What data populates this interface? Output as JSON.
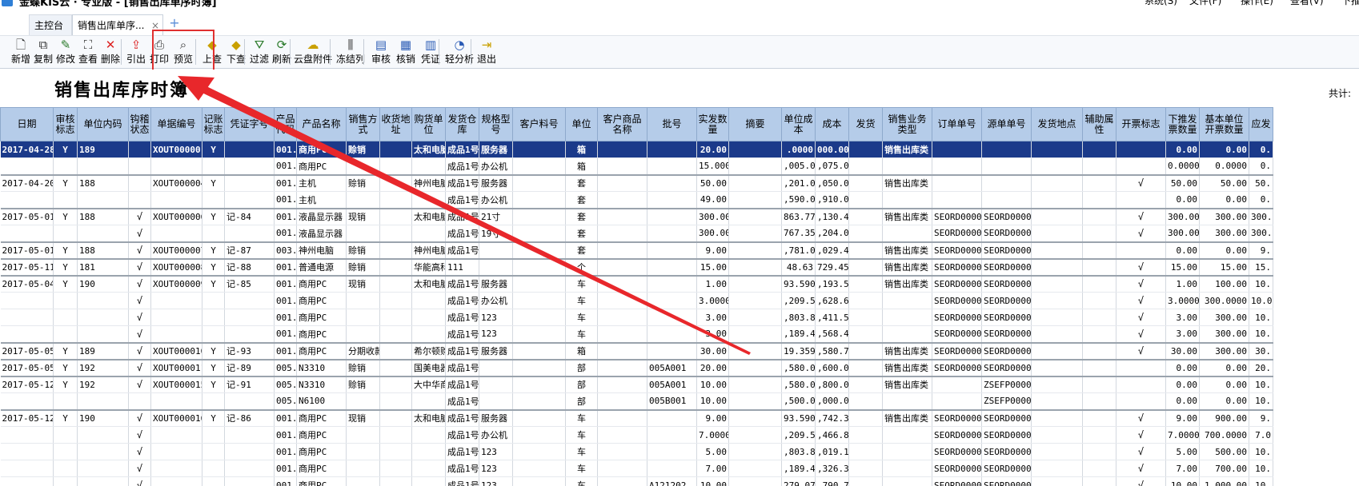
{
  "window": {
    "title": "金蝶KIS云 · 专业版 - [销售出库单序时簿]",
    "menus": [
      "系统(S)",
      "文件(F)",
      "操作(E)",
      "查看(V)",
      "下推(P)"
    ]
  },
  "tabs": {
    "main": "主控台",
    "active": "销售出库单序...",
    "close": "×",
    "add": "+"
  },
  "toolbar": {
    "buttons": [
      {
        "label": "新增",
        "icon": "new-doc-icon",
        "glyph": "🗋"
      },
      {
        "label": "复制",
        "icon": "copy-icon",
        "glyph": "⧉"
      },
      {
        "label": "修改",
        "icon": "edit-icon",
        "glyph": "✎"
      },
      {
        "label": "查看",
        "icon": "binoculars-icon",
        "glyph": "⛶"
      },
      {
        "label": "删除",
        "icon": "delete-icon",
        "glyph": "✕"
      },
      {
        "label": "引出",
        "icon": "export-icon",
        "glyph": "⇪"
      },
      {
        "label": "打印",
        "icon": "print-icon",
        "glyph": "⎙"
      },
      {
        "label": "预览",
        "icon": "preview-icon",
        "glyph": "⌕"
      },
      {
        "label": "上查",
        "icon": "up-query-icon",
        "glyph": "◆"
      },
      {
        "label": "下查",
        "icon": "down-query-icon",
        "glyph": "◆"
      },
      {
        "label": "过滤",
        "icon": "filter-icon",
        "glyph": "⛛"
      },
      {
        "label": "刷新",
        "icon": "refresh-icon",
        "glyph": "⟳"
      },
      {
        "label": "云盘附件",
        "icon": "cloud-attach-icon",
        "glyph": "☁"
      },
      {
        "label": "冻结列",
        "icon": "freeze-column-icon",
        "glyph": "⫼"
      },
      {
        "label": "审核",
        "icon": "audit-icon",
        "glyph": "▤"
      },
      {
        "label": "核销",
        "icon": "writeoff-icon",
        "glyph": "▦"
      },
      {
        "label": "凭证",
        "icon": "voucher-icon",
        "glyph": "▥"
      },
      {
        "label": "轻分析",
        "icon": "analysis-icon",
        "glyph": "◔"
      },
      {
        "label": "退出",
        "icon": "exit-icon",
        "glyph": "⇥"
      }
    ]
  },
  "report": {
    "title": "销售出库序时簿",
    "total_label": "共计:"
  },
  "colors": {
    "header_bg": "#b5cce9",
    "selected_row_bg": "#1b3a8a",
    "annotation_red": "#e03030"
  },
  "table": {
    "columns": [
      "日期",
      "审核标志",
      "单位内码",
      "钩稽状态",
      "单据编号",
      "记账标志",
      "凭证字号",
      "产品代码",
      "产品名称",
      "销售方式",
      "收货地址",
      "购货单位",
      "发货仓库",
      "规格型号",
      "客户料号",
      "单位",
      "客户商品名称",
      "批号",
      "实发数量",
      "摘要",
      "单位成本",
      "成本",
      "发货",
      "销售业务类型",
      "订单单号",
      "源单单号",
      "发货地点",
      "辅助属性",
      "开票标志",
      "下推发票数量",
      "基本单位开票数量",
      "应发"
    ],
    "rows": [
      {
        "sel": true,
        "gb": true,
        "c": [
          "2017-04-28",
          "Y",
          "189",
          "",
          "XOUT00000",
          "Y",
          "",
          "001.",
          "商用PC",
          "赊销",
          "",
          "太和电脑",
          "成品1号",
          "服务器",
          "",
          "箱",
          "",
          "",
          "20.00",
          "",
          ".0000",
          "000.00",
          "",
          "销售出库类",
          "",
          "",
          "",
          "",
          "",
          "0.00",
          "0.00",
          "0."
        ]
      },
      {
        "sel": false,
        "gb": false,
        "c": [
          "",
          "",
          "",
          "",
          "",
          "",
          "",
          "001.",
          "商用PC",
          "",
          "",
          "",
          "成品1号",
          "办公机",
          "",
          "箱",
          "",
          "",
          "15.0000",
          "",
          ",005.00",
          ",075.00",
          "",
          "",
          "",
          "",
          "",
          "",
          "",
          "0.0000",
          "0.0000",
          "0."
        ]
      },
      {
        "sel": false,
        "gb": true,
        "c": [
          "2017-04-20",
          "Y",
          "188",
          "",
          "XOUT000004",
          "Y",
          "",
          "001.",
          "主机",
          "赊销",
          "",
          "神州电脑",
          "成品1号",
          "服务器",
          "",
          "套",
          "",
          "",
          "50.00",
          "",
          ",201.00",
          ",050.00",
          "",
          "销售出库类",
          "",
          "",
          "",
          "",
          "√",
          "50.00",
          "50.00",
          "50."
        ]
      },
      {
        "sel": false,
        "gb": false,
        "c": [
          "",
          "",
          "",
          "",
          "",
          "",
          "",
          "001.",
          "主机",
          "",
          "",
          "",
          "成品1号",
          "办公机",
          "",
          "套",
          "",
          "",
          "49.00",
          "",
          ",590.00",
          ",910.00",
          "",
          "",
          "",
          "",
          "",
          "",
          "",
          "0.00",
          "0.00",
          "0."
        ]
      },
      {
        "sel": false,
        "gb": true,
        "c": [
          "2017-05-01",
          "Y",
          "188",
          "√",
          "XOUT000006",
          "Y",
          "记-84",
          "001.",
          "液晶显示器",
          "现销",
          "",
          "太和电脑",
          "成品1号",
          "21寸",
          "",
          "套",
          "",
          "",
          "300.00",
          "",
          "863.77",
          ",130.43",
          "",
          "销售出库类",
          "SEORD000001",
          "SEORD000001",
          "",
          "",
          "√",
          "300.00",
          "300.00",
          "300."
        ]
      },
      {
        "sel": false,
        "gb": false,
        "c": [
          "",
          "",
          "",
          "√",
          "",
          "",
          "",
          "001.",
          "液晶显示器",
          "",
          "",
          "",
          "成品1号",
          "19寸",
          "",
          "套",
          "",
          "",
          "300.00",
          "",
          "767.35",
          ",204.08",
          "",
          "",
          "SEORD000001",
          "SEORD000001",
          "",
          "",
          "√",
          "300.00",
          "300.00",
          "300."
        ]
      },
      {
        "sel": false,
        "gb": true,
        "c": [
          "2017-05-01",
          "Y",
          "188",
          "√",
          "XOUT000007",
          "Y",
          "记-87",
          "003.",
          "神州电脑",
          "赊销",
          "",
          "神州电脑",
          "成品1号",
          "",
          "",
          "套",
          "",
          "",
          "9.00",
          "",
          ",781.05",
          ",029.41",
          "",
          "销售出库类",
          "SEORD000002",
          "SEORD000002",
          "",
          "",
          "",
          "0.00",
          "0.00",
          "9."
        ]
      },
      {
        "sel": false,
        "gb": true,
        "c": [
          "2017-05-11",
          "Y",
          "181",
          "√",
          "XOUT000008",
          "Y",
          "记-88",
          "001.",
          "普通电源",
          "赊销",
          "",
          "华能高科",
          "111",
          "",
          "",
          "个",
          "",
          "",
          "15.00",
          "",
          "48.63",
          "729.45",
          "",
          "销售出库类",
          "SEORD000003",
          "SEORD000003",
          "",
          "",
          "√",
          "15.00",
          "15.00",
          "15."
        ]
      },
      {
        "sel": false,
        "gb": true,
        "c": [
          "2017-05-04",
          "Y",
          "190",
          "√",
          "XOUT000009",
          "Y",
          "记-85",
          "001.",
          "商用PC",
          "现销",
          "",
          "太和电脑",
          "成品1号",
          "服务器",
          "",
          "车",
          "",
          "",
          "1.00",
          "",
          "93.5903",
          ",193.59",
          "",
          "销售出库类",
          "SEORD000004",
          "SEORD000004",
          "",
          "",
          "√",
          "1.00",
          "100.00",
          "10."
        ]
      },
      {
        "sel": false,
        "gb": false,
        "c": [
          "",
          "",
          "",
          "√",
          "",
          "",
          "",
          "001.",
          "商用PC",
          "",
          "",
          "",
          "成品1号",
          "办公机",
          "",
          "车",
          "",
          "",
          "3.0000",
          "",
          ",209.55",
          ",628.65",
          "",
          "",
          "SEORD000004",
          "SEORD000004",
          "",
          "",
          "√",
          "3.0000",
          "300.0000",
          "10.0"
        ]
      },
      {
        "sel": false,
        "gb": false,
        "c": [
          "",
          "",
          "",
          "√",
          "",
          "",
          "",
          "001.",
          "商用PC",
          "",
          "",
          "",
          "成品1号",
          "123",
          "",
          "车",
          "",
          "",
          "3.00",
          "",
          ",803.84",
          ",411.51",
          "",
          "",
          "SEORD000004",
          "SEORD000004",
          "",
          "",
          "√",
          "3.00",
          "300.00",
          "10."
        ]
      },
      {
        "sel": false,
        "gb": false,
        "c": [
          "",
          "",
          "",
          "√",
          "",
          "",
          "",
          "001.",
          "商用PC",
          "",
          "",
          "",
          "成品1号",
          "123",
          "",
          "车",
          "",
          "",
          "3.00",
          "",
          ",189.48",
          ",568.44",
          "",
          "",
          "SEORD000004",
          "SEORD000004",
          "",
          "",
          "√",
          "3.00",
          "300.00",
          "10."
        ]
      },
      {
        "sel": false,
        "gb": true,
        "c": [
          "2017-05-05",
          "Y",
          "189",
          "√",
          "XOUT000010",
          "Y",
          "记-93",
          "001.",
          "商用PC",
          "分期收款",
          "",
          "希尔顿购",
          "成品1号",
          "服务器",
          "",
          "箱",
          "",
          "",
          "30.00",
          "",
          "19.3590",
          ",580.77",
          "",
          "销售出库类",
          "SEORD000006",
          "SEORD000006",
          "",
          "",
          "√",
          "30.00",
          "300.00",
          "30."
        ]
      },
      {
        "sel": false,
        "gb": true,
        "c": [
          "2017-05-05",
          "Y",
          "192",
          "√",
          "XOUT000011",
          "Y",
          "记-89",
          "005.",
          "N3310",
          "赊销",
          "",
          "国美电器",
          "成品1号",
          "",
          "",
          "部",
          "",
          "005A001",
          "20.00",
          "",
          ",580.00",
          ",600.00",
          "",
          "销售出库类",
          "SEORD000008",
          "SEORD000008",
          "",
          "",
          "",
          "0.00",
          "0.00",
          "20."
        ]
      },
      {
        "sel": false,
        "gb": true,
        "c": [
          "2017-05-12",
          "Y",
          "192",
          "√",
          "XOUT000015",
          "Y",
          "记-91",
          "005.",
          "N3310",
          "赊销",
          "",
          "大中华商",
          "成品1号",
          "",
          "",
          "部",
          "",
          "005A001",
          "10.00",
          "",
          ",580.00",
          ",800.00",
          "",
          "销售出库类",
          "",
          "ZSEFP000006",
          "",
          "",
          "",
          "0.00",
          "0.00",
          "10."
        ]
      },
      {
        "sel": false,
        "gb": false,
        "c": [
          "",
          "",
          "",
          "",
          "",
          "",
          "",
          "005.",
          "N6100",
          "",
          "",
          "",
          "成品1号",
          "",
          "",
          "部",
          "",
          "005B001",
          "10.00",
          "",
          ",500.00",
          ",000.00",
          "",
          "",
          "",
          "ZSEFP000006",
          "",
          "",
          "",
          "0.00",
          "0.00",
          "10."
        ]
      },
      {
        "sel": false,
        "gb": true,
        "c": [
          "2017-05-12",
          "Y",
          "190",
          "√",
          "XOUT000016",
          "Y",
          "记-86",
          "001.",
          "商用PC",
          "现销",
          "",
          "太和电脑",
          "成品1号",
          "服务器",
          "",
          "车",
          "",
          "",
          "9.00",
          "",
          "93.5903",
          ",742.31",
          "",
          "销售出库类",
          "SEORD000004",
          "SEORD000004",
          "",
          "",
          "√",
          "9.00",
          "900.00",
          "9."
        ]
      },
      {
        "sel": false,
        "gb": false,
        "c": [
          "",
          "",
          "",
          "√",
          "",
          "",
          "",
          "001.",
          "商用PC",
          "",
          "",
          "",
          "成品1号",
          "办公机",
          "",
          "车",
          "",
          "",
          "7.0000",
          "",
          ",209.55",
          ",466.85",
          "",
          "",
          "SEORD000004",
          "SEORD000004",
          "",
          "",
          "√",
          "7.0000",
          "700.0000",
          "7.0"
        ]
      },
      {
        "sel": false,
        "gb": false,
        "c": [
          "",
          "",
          "",
          "√",
          "",
          "",
          "",
          "001.",
          "商用PC",
          "",
          "",
          "",
          "成品1号",
          "123",
          "",
          "车",
          "",
          "",
          "5.00",
          "",
          ",803.84",
          ",019.18",
          "",
          "",
          "SEORD000004",
          "SEORD000004",
          "",
          "",
          "√",
          "5.00",
          "500.00",
          "10."
        ]
      },
      {
        "sel": false,
        "gb": false,
        "c": [
          "",
          "",
          "",
          "√",
          "",
          "",
          "",
          "001.",
          "商用PC",
          "",
          "",
          "",
          "成品1号",
          "123",
          "",
          "车",
          "",
          "",
          "7.00",
          "",
          ",189.48",
          ",326.37",
          "",
          "",
          "SEORD000004",
          "SEORD000004",
          "",
          "",
          "√",
          "7.00",
          "700.00",
          "10."
        ]
      },
      {
        "sel": false,
        "gb": false,
        "c": [
          "",
          "",
          "",
          "√",
          "",
          "",
          "",
          "001.",
          "商用PC",
          "",
          "",
          "",
          "成品1号",
          "123",
          "",
          "车",
          "",
          "A121202",
          "10.00",
          "",
          "279.07",
          ",790.70",
          "",
          "",
          "SEORD000004",
          "SEORD000004",
          "",
          "",
          "√",
          "10.00",
          "1,000.00",
          "10."
        ]
      }
    ]
  }
}
